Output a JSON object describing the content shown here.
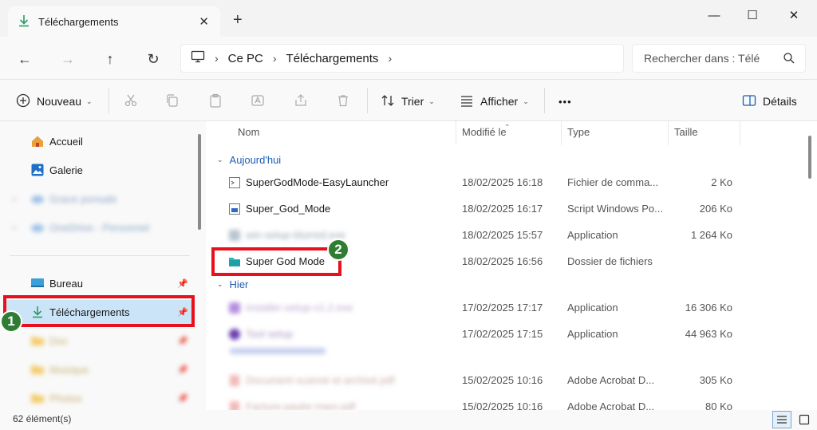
{
  "tab": {
    "title": "Téléchargements",
    "close": "✕",
    "new_tab": "+"
  },
  "window_controls": {
    "minimize": "—",
    "maximize": "☐",
    "close": "✕"
  },
  "nav": {
    "back": "←",
    "forward": "→",
    "up": "↑",
    "refresh": "↻"
  },
  "breadcrumb": {
    "items": [
      "Ce PC",
      "Téléchargements"
    ],
    "sep": "›"
  },
  "search": {
    "placeholder": "Rechercher dans : Télé"
  },
  "toolbar": {
    "new_label": "Nouveau",
    "sort_label": "Trier",
    "view_label": "Afficher",
    "more": "•••",
    "details_label": "Détails"
  },
  "sidebar": {
    "home": "Accueil",
    "gallery": "Galerie",
    "blurred1": "Grace ponsale",
    "blurred2": "OneDrive - Personnel",
    "desktop": "Bureau",
    "downloads": "Téléchargements",
    "blurred3": "Doc",
    "blurred4": "Musique",
    "blurred5": "Photos"
  },
  "columns": {
    "name": "Nom",
    "modified": "Modifié le",
    "type": "Type",
    "size": "Taille"
  },
  "groups": {
    "today": "Aujourd'hui",
    "yesterday": "Hier"
  },
  "rows": [
    {
      "name": "SuperGodMode-EasyLauncher",
      "date": "18/02/2025 16:18",
      "type": "Fichier de comma...",
      "size": "2 Ko"
    },
    {
      "name": "Super_God_Mode",
      "date": "18/02/2025 16:17",
      "type": "Script Windows Po...",
      "size": "206 Ko"
    },
    {
      "name": "win-setup-blurred.exe",
      "date": "18/02/2025 15:57",
      "type": "Application",
      "size": "1 264 Ko"
    },
    {
      "name": "Super God Mode",
      "date": "18/02/2025 16:56",
      "type": "Dossier de fichiers",
      "size": ""
    },
    {
      "name": "installer-setup-v1.2.exe",
      "date": "17/02/2025 17:17",
      "type": "Application",
      "size": "16 306 Ko"
    },
    {
      "name": "Tool setup",
      "date": "17/02/2025 17:15",
      "type": "Application",
      "size": "44 963 Ko"
    },
    {
      "name": "Document scanné et archivé.pdf",
      "date": "15/02/2025 10:16",
      "type": "Adobe Acrobat D...",
      "size": "305 Ko"
    },
    {
      "name": "Facture payée mars.pdf",
      "date": "15/02/2025 10:16",
      "type": "Adobe Acrobat D...",
      "size": "80 Ko"
    }
  ],
  "status": {
    "count": "62 élément(s)"
  },
  "badges": {
    "one": "1",
    "two": "2"
  },
  "colors": {
    "accent": "#1a5fb4",
    "selected": "#cce4f7",
    "annotation": "#e8101c",
    "badge": "#2e7d32"
  }
}
